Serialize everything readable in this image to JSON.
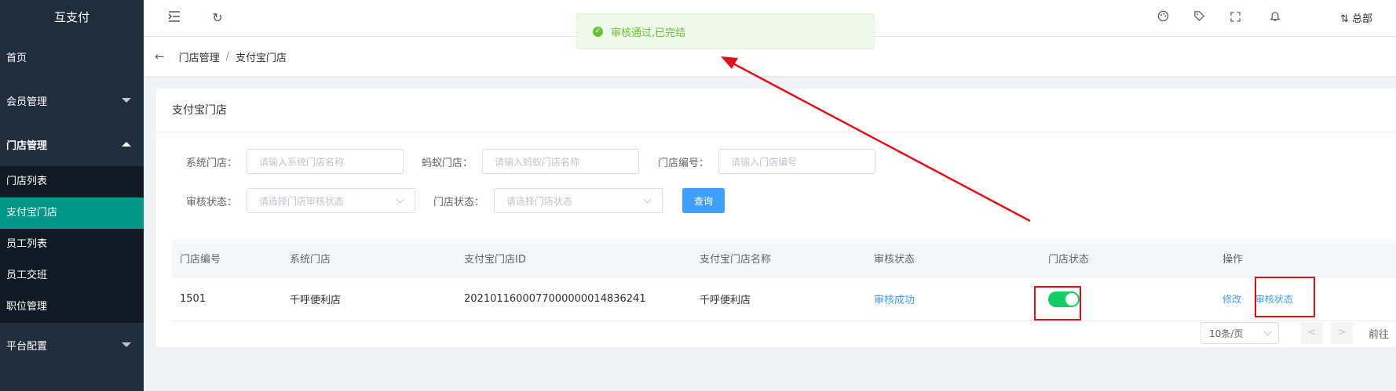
{
  "brand": "互支付",
  "sidebar": {
    "items": [
      {
        "label": "首页"
      },
      {
        "label": "会员管理"
      },
      {
        "label": "门店管理"
      },
      {
        "label": "平台配置"
      }
    ],
    "submenu": [
      {
        "label": "门店列表"
      },
      {
        "label": "支付宝门店"
      },
      {
        "label": "员工列表"
      },
      {
        "label": "员工交班"
      },
      {
        "label": "职位管理"
      }
    ]
  },
  "header": {
    "user": "总部"
  },
  "toast": {
    "message": "审核通过,已完结"
  },
  "breadcrumb": {
    "parent": "门店管理",
    "current": "支付宝门店"
  },
  "card": {
    "title": "支付宝门店"
  },
  "filters": {
    "system_store_label": "系统门店：",
    "system_store_placeholder": "请输入系统门店名称",
    "ant_store_label": "蚂蚁门店：",
    "ant_store_placeholder": "请输入蚂蚁门店名称",
    "store_no_label": "门店编号：",
    "store_no_placeholder": "请输入门店编号",
    "audit_status_label": "审核状态：",
    "audit_status_placeholder": "请选择门店审核状态",
    "store_status_label": "门店状态：",
    "store_status_placeholder": "请选择门店状态",
    "query_label": "查询"
  },
  "table": {
    "headers": [
      "门店编号",
      "系统门店",
      "支付宝门店ID",
      "支付宝门店名称",
      "审核状态",
      "门店状态",
      "操作"
    ],
    "rows": [
      {
        "store_no": "1501",
        "system_store": "千呼便利店",
        "alipay_id": "2021011600077000000014836241",
        "alipay_name": "千呼便利店",
        "audit_status": "审核成功",
        "store_status_on": true,
        "actions": [
          "修改",
          "审核状态"
        ]
      }
    ]
  },
  "pager": {
    "size": "10条/页",
    "prev": "<",
    "next": ">",
    "goto": "前往"
  },
  "colors": {
    "accent": "#009688",
    "primary": "#409eff",
    "success": "#67c23a",
    "switch_on": "#13ce66",
    "annotation": "#e0101a"
  }
}
